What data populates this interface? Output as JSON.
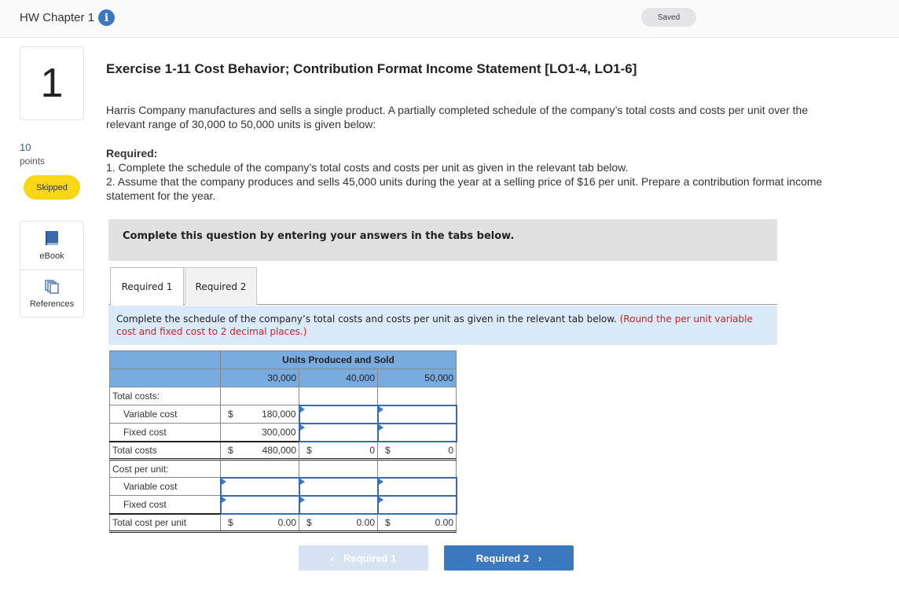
{
  "header": {
    "assignment_title": "HW Chapter 1",
    "info_icon": "info-icon",
    "save_status": "Saved"
  },
  "question": {
    "number": "1",
    "points_value": "10",
    "points_label": "points",
    "status": "Skipped",
    "title": "Exercise 1-11 Cost Behavior; Contribution Format Income Statement [LO1-4, LO1-6]",
    "intro": "Harris Company manufactures and sells a single product. A partially completed schedule of the company’s total costs and costs per unit over the relevant range of 30,000 to 50,000 units is given below:",
    "required_heading": "Required:",
    "required_items": [
      "1. Complete the schedule of the company’s total costs and costs per unit as given in the relevant tab below.",
      "2. Assume that the company produces and sells 45,000 units during the year at a selling price of $16 per unit. Prepare a contribution format income statement for the year."
    ]
  },
  "resources": [
    {
      "label": "eBook",
      "icon": "book-icon"
    },
    {
      "label": "References",
      "icon": "references-icon"
    }
  ],
  "banner": "Complete this question by entering your answers in the tabs below.",
  "tabs": [
    {
      "label": "Required 1",
      "active": true
    },
    {
      "label": "Required 2",
      "active": false
    }
  ],
  "tab_instruction": {
    "text": "Complete the schedule of the company’s total costs and costs per unit as given in the relevant tab below.",
    "hint": "(Round the per unit variable cost and fixed cost to 2 decimal places.)"
  },
  "schedule": {
    "group_header": "Units Produced and Sold",
    "columns": [
      "30,000",
      "40,000",
      "50,000"
    ],
    "total_costs_label": "Total costs:",
    "variable_cost_label": "Variable cost",
    "fixed_cost_label": "Fixed cost",
    "total_costs_row_label": "Total costs",
    "cost_per_unit_label": "Cost per unit:",
    "unit_variable_label": "Variable cost",
    "unit_fixed_label": "Fixed cost",
    "total_per_unit_label": "Total cost per unit",
    "currency": "$",
    "variable_cost_values": [
      "180,000",
      "",
      ""
    ],
    "fixed_cost_values": [
      "300,000",
      "",
      ""
    ],
    "total_costs_values": [
      "480,000",
      "0",
      "0"
    ],
    "unit_variable_values": [
      "",
      "",
      ""
    ],
    "unit_fixed_values": [
      "",
      "",
      ""
    ],
    "total_per_unit_values": [
      "0.00",
      "0.00",
      "0.00"
    ]
  },
  "navigation": {
    "prev_label": "Required 1",
    "next_label": "Required 2",
    "prev_enabled": false
  }
}
